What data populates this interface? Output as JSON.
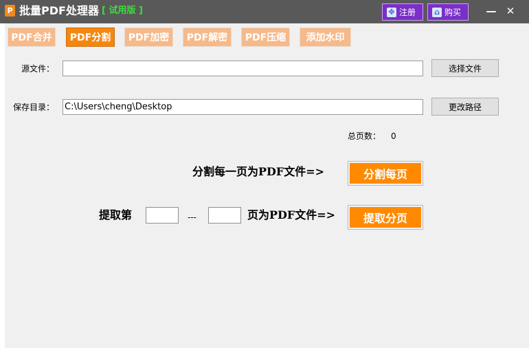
{
  "window": {
    "logo_glyph": "P",
    "title": "批量PDF处理器",
    "trial_tag": "[ 试用版 ]",
    "register_label": "注册",
    "buy_label": "购买",
    "minimize_glyph": "—",
    "close_glyph": "✕"
  },
  "tabs": [
    {
      "label": "PDF合并",
      "active": false
    },
    {
      "label": "PDF分割",
      "active": true
    },
    {
      "label": "PDF加密",
      "active": false
    },
    {
      "label": "PDF解密",
      "active": false
    },
    {
      "label": "PDF压缩",
      "active": false
    },
    {
      "label": "添加水印",
      "active": false
    }
  ],
  "form": {
    "source_label": "源文件：",
    "source_value": "",
    "choose_file_label": "选择文件",
    "save_dir_label": "保存目录：",
    "save_dir_value": "C:\\Users\\cheng\\Desktop",
    "change_path_label": "更改路径",
    "total_pages_label": "总页数：",
    "total_pages_value": "0"
  },
  "split": {
    "each_page_label": "分割每一页为PDF文件=>",
    "each_page_button": "分割每页",
    "extract_prefix": "提取第",
    "extract_from": "",
    "range_separator": "---",
    "extract_to": "",
    "extract_suffix": "页为PDF文件=>",
    "extract_button": "提取分页"
  },
  "colors": {
    "titlebar": "#595959",
    "accent_orange": "#ff8a00",
    "trial_green": "#3cdc3c",
    "purple_button": "#7a2fc6"
  }
}
